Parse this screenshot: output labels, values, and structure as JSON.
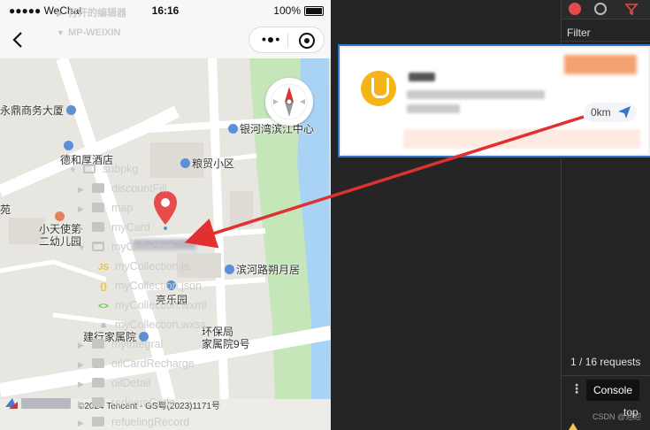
{
  "status_bar": {
    "carrier": "●●●●● WeChat",
    "time": "16:16",
    "battery": "100%"
  },
  "navbar": {
    "back_icon": "chevron-left-icon",
    "menu_icon": "more-dots-icon",
    "close_icon": "target-circle-icon"
  },
  "map": {
    "pois": [
      {
        "label": "永鼎商务大厦",
        "icon": "place-icon"
      },
      {
        "label": "德和厚酒店",
        "icon": "place-icon"
      },
      {
        "label": "粮贸小区",
        "icon": "place-icon"
      },
      {
        "label": "银河湾滨江中心",
        "icon": "place-icon"
      },
      {
        "label": "小天使第\n二幼儿园",
        "icon": "school-icon"
      },
      {
        "label": "滨河路朔月居",
        "icon": "place-icon"
      },
      {
        "label": "亮乐园",
        "icon": "place-icon"
      },
      {
        "label": "建行家属院",
        "icon": "place-icon"
      },
      {
        "label": "环保局\n家属院9号",
        "icon": "place-icon"
      },
      {
        "label": "苑",
        "icon": ""
      }
    ],
    "copyright": "©2024 Tencent - GS粤(2023)1171号",
    "compass_icon": "compass-icon",
    "pin_icon": "map-pin-icon"
  },
  "file_tree": {
    "sections": [
      "打开的编辑器",
      "MP-WEIXIN"
    ],
    "items": [
      {
        "label": "subpkg",
        "type": "folder",
        "expanded": true,
        "depth": 0
      },
      {
        "label": "discountFill",
        "type": "folder",
        "expanded": false,
        "depth": 1
      },
      {
        "label": "map",
        "type": "folder",
        "expanded": false,
        "depth": 1
      },
      {
        "label": "myCard",
        "type": "folder",
        "expanded": false,
        "depth": 1
      },
      {
        "label": "myCollection",
        "type": "folder",
        "expanded": true,
        "depth": 1
      },
      {
        "label": "myCollection.js",
        "type": "js",
        "depth": 2
      },
      {
        "label": "myCollection.json",
        "type": "json",
        "depth": 2
      },
      {
        "label": "myCollection.wxml",
        "type": "wxml",
        "depth": 2
      },
      {
        "label": "myCollection.wxss",
        "type": "wxss",
        "depth": 2
      },
      {
        "label": "myIntegral",
        "type": "folder",
        "expanded": false,
        "depth": 1
      },
      {
        "label": "oilCardRecharge",
        "type": "folder",
        "expanded": false,
        "depth": 1
      },
      {
        "label": "oilDetail",
        "type": "folder",
        "expanded": false,
        "depth": 1
      },
      {
        "label": "redeemCode",
        "type": "folder",
        "expanded": false,
        "depth": 1
      },
      {
        "label": "refuelingRecord",
        "type": "folder",
        "expanded": false,
        "depth": 1
      }
    ]
  },
  "network_panel": {
    "filter_label": "Filter",
    "requests": "1 / 16 requests",
    "console_tab": "Console",
    "context": "top",
    "watermark": "CSDN @迎迎"
  },
  "card": {
    "distance": "0km",
    "share_icon": "send-icon",
    "logo_icon": "gas-station-logo-icon"
  },
  "colors": {
    "accent_red": "#e0302f",
    "pin_red": "#e74c4c",
    "card_border": "#2f77c9",
    "logo_yellow": "#f5b516"
  }
}
